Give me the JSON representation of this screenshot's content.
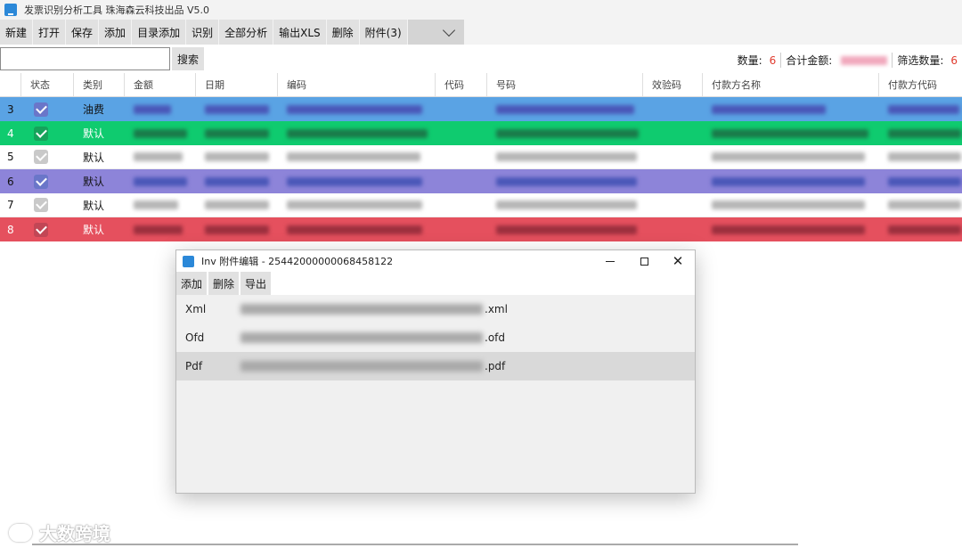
{
  "window": {
    "title": "发票识别分析工具 珠海森云科技出品 V5.0",
    "icon": "app-download-icon"
  },
  "toolbar": [
    "新建",
    "打开",
    "保存",
    "添加",
    "目录添加",
    "识别",
    "全部分析",
    "输出XLS",
    "删除",
    "附件(3)"
  ],
  "search": {
    "value": "",
    "button": "搜索"
  },
  "stats": {
    "count_label": "数量:",
    "count_value": "6",
    "total_label": "合计金额:",
    "filter_label": "筛选数量:",
    "filter_value": "6"
  },
  "columns": [
    "",
    "状态",
    "类别",
    "金额",
    "日期",
    "编码",
    "代码",
    "号码",
    "效验码",
    "付款方名称",
    "付款方代码"
  ],
  "rows": [
    {
      "num": "3",
      "category": "油费",
      "color": "#5aa3e4"
    },
    {
      "num": "4",
      "category": "默认",
      "color": "#0fcb6f"
    },
    {
      "num": "5",
      "category": "默认",
      "color": "#ffffff"
    },
    {
      "num": "6",
      "category": "默认",
      "color": "#8d84d9"
    },
    {
      "num": "7",
      "category": "默认",
      "color": "#ffffff"
    },
    {
      "num": "8",
      "category": "默认",
      "color": "#e5505e"
    }
  ],
  "dialog": {
    "title": "Inv 附件编辑 - 25442000000068458122",
    "buttons": [
      "添加",
      "删除",
      "导出"
    ],
    "attachments": [
      {
        "type": "Xml",
        "ext": ".xml"
      },
      {
        "type": "Ofd",
        "ext": ".ofd"
      },
      {
        "type": "Pdf",
        "ext": ".pdf"
      }
    ]
  },
  "watermark": "大数跨境"
}
